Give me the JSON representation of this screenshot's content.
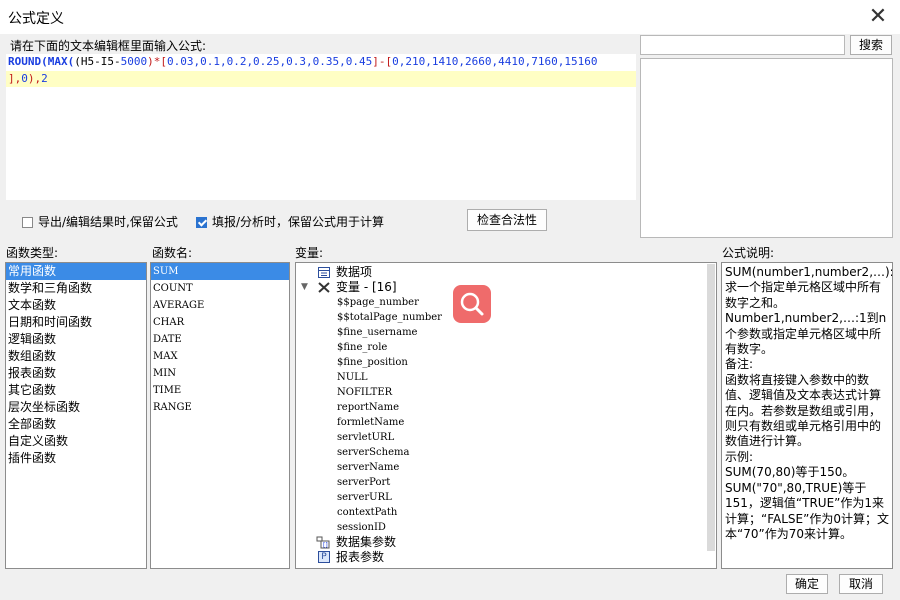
{
  "dialog": {
    "title": "公式定义",
    "close_label": "✕"
  },
  "prompt": "请在下面的文本编辑框里面输入公式:",
  "formula": {
    "line1": [
      {
        "t": "ROUND(MAX(",
        "c": "kw"
      },
      {
        "t": "(H5-I5-",
        "c": "pl"
      },
      {
        "t": "5000",
        "c": "nm"
      },
      {
        "t": ")*[",
        "c": "op"
      },
      {
        "t": "0.03,0.1,0.2,0.25,0.3,0.35,0.45",
        "c": "nm"
      },
      {
        "t": "]-[",
        "c": "op"
      },
      {
        "t": "0,210,1410,2660,4410,7160,15160",
        "c": "nm"
      }
    ],
    "line2": [
      {
        "t": "],",
        "c": "op"
      },
      {
        "t": "0",
        "c": "nm"
      },
      {
        "t": "),",
        "c": "op"
      },
      {
        "t": "2",
        "c": "nm"
      }
    ]
  },
  "options": {
    "export_keep": {
      "label": "导出/编辑结果时,保留公式",
      "checked": false
    },
    "fill_keep": {
      "label": "填报/分析时，保留公式用于计算",
      "checked": true
    },
    "check_button": "检查合法性"
  },
  "search": {
    "placeholder": "",
    "button": "搜索"
  },
  "function_types": {
    "label": "函数类型:",
    "items": [
      "常用函数",
      "数学和三角函数",
      "文本函数",
      "日期和时间函数",
      "逻辑函数",
      "数组函数",
      "报表函数",
      "其它函数",
      "层次坐标函数",
      "全部函数",
      "自定义函数",
      "插件函数"
    ],
    "selected": 0
  },
  "function_names": {
    "label": "函数名:",
    "items": [
      "SUM",
      "COUNT",
      "AVERAGE",
      "CHAR",
      "DATE",
      "MAX",
      "MIN",
      "TIME",
      "RANGE"
    ],
    "selected": 0
  },
  "variables": {
    "label": "变量:",
    "data_items": "数据项",
    "vars_label": "变量 - [16]",
    "vars": [
      "$$page_number",
      "$$totalPage_number",
      "$fine_username",
      "$fine_role",
      "$fine_position",
      "NULL",
      "NOFILTER",
      "reportName",
      "formletName",
      "servletURL",
      "serverSchema",
      "serverName",
      "serverPort",
      "serverURL",
      "contextPath",
      "sessionID"
    ],
    "dataset_params": "数据集参数",
    "report_params": "报表参数"
  },
  "description": {
    "label": "公式说明:",
    "paragraphs": [
      "SUM(number1,number2,…):求一个指定单元格区域中所有数字之和。",
      "Number1,number2,…:1到n个参数或指定单元格区域中所有数字。",
      "备注:",
      "函数将直接键入参数中的数值、逻辑值及文本表达式计算在内。若参数是数组或引用，则只有数组或单元格引用中的数值进行计算。",
      "示例:",
      "SUM(70,80)等于150。",
      "SUM(\"70\",80,TRUE)等于151，逻辑值“TRUE”作为1来计算；“FALSE”作为0计算；文本“70”作为70来计算。"
    ]
  },
  "buttons": {
    "ok": "确定",
    "cancel": "取消"
  },
  "colors": {
    "accent": "#3b8be6",
    "highlight_line": "#fffec4",
    "search_overlay": "#ef6b6b"
  }
}
